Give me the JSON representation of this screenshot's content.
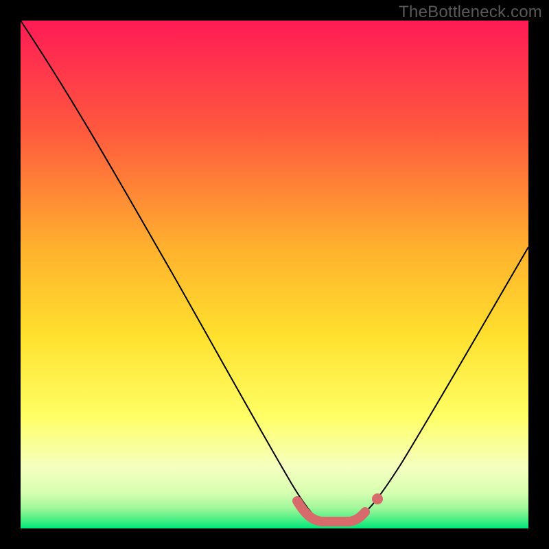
{
  "watermark": "TheBottleneck.com",
  "colors": {
    "top": "#ff1b56",
    "mid_upper": "#ff7a3a",
    "mid": "#ffd22e",
    "mid_lower": "#ffff66",
    "lower": "#f2ffb3",
    "bottom": "#00e67a",
    "curve": "#000000",
    "marker": "#d76b6b"
  },
  "chart_data": {
    "type": "line",
    "title": "",
    "xlabel": "",
    "ylabel": "",
    "xlim": [
      0,
      100
    ],
    "ylim": [
      0,
      100
    ],
    "series": [
      {
        "name": "bottleneck-curve",
        "x": [
          0,
          5,
          10,
          15,
          20,
          25,
          30,
          35,
          40,
          45,
          50,
          55,
          58,
          60,
          62,
          64,
          68,
          72,
          76,
          80,
          84,
          88,
          92,
          96,
          100
        ],
        "values": [
          100,
          91,
          82,
          73,
          64,
          55,
          46,
          37,
          29,
          21,
          13,
          6,
          2,
          1,
          1,
          1,
          2,
          6,
          12,
          19,
          27,
          35,
          43,
          51,
          59
        ]
      }
    ],
    "markers": [
      {
        "name": "optimum-band-left-end",
        "x": 55,
        "y": 5
      },
      {
        "name": "optimum-band-right-end",
        "x": 68,
        "y": 4
      }
    ],
    "optimum_band": {
      "x_start": 55,
      "x_end": 68,
      "y": 1
    }
  }
}
